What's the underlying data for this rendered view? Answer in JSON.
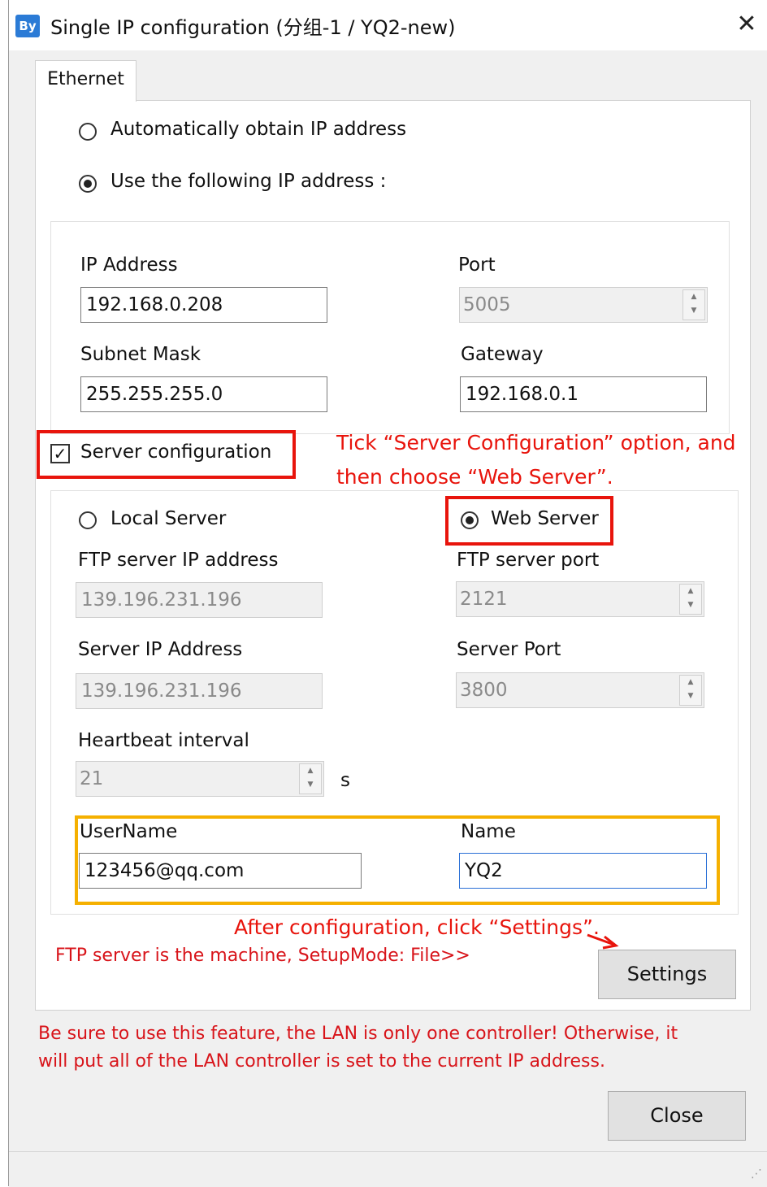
{
  "window": {
    "title": "Single IP configuration   (分组-1 / YQ2-new)",
    "icon_text": "By",
    "close_glyph": "✕"
  },
  "tabs": [
    {
      "label": "Ethernet",
      "selected": true
    }
  ],
  "ip_mode": {
    "auto_label": "Automatically obtain IP address",
    "manual_label": "Use the following IP address :",
    "selected": "manual"
  },
  "network": {
    "ip_label": "IP Address",
    "ip_value": "192.168.0.208",
    "port_label": "Port",
    "port_value": "5005",
    "mask_label": "Subnet Mask",
    "mask_value": "255.255.255.0",
    "gateway_label": "Gateway",
    "gateway_value": "192.168.0.1"
  },
  "server_config": {
    "checkbox_label": "Server configuration",
    "checked": true,
    "local_label": "Local Server",
    "web_label": "Web Server",
    "selected": "web",
    "ftp_ip_label": "FTP server IP address",
    "ftp_ip_value": "139.196.231.196",
    "ftp_port_label": "FTP server port",
    "ftp_port_value": "2121",
    "server_ip_label": "Server IP Address",
    "server_ip_value": "139.196.231.196",
    "server_port_label": "Server Port",
    "server_port_value": "3800",
    "heartbeat_label": "Heartbeat interval",
    "heartbeat_value": "21",
    "heartbeat_unit": "s",
    "username_label": "UserName",
    "username_value": "123456@qq.com",
    "name_label": "Name",
    "name_value": "YQ2"
  },
  "notes": {
    "ftp_note": "FTP server is the machine, SetupMode: File>>",
    "warning_line1": "Be sure to use this feature, the LAN is only one controller! Otherwise, it",
    "warning_line2": "will put all of the LAN controller is set to the current IP address."
  },
  "annotations": {
    "tick_line1": "Tick  “Server  Configuration”  option,  and",
    "tick_line2": "then choose “Web Server”.",
    "after_config": "After configuration, click “Settings”."
  },
  "buttons": {
    "settings": "Settings",
    "close": "Close"
  },
  "colors": {
    "annotation_red": "#e8140c",
    "highlight_yellow": "#f5b000",
    "focus_blue": "#2a6fd6"
  }
}
